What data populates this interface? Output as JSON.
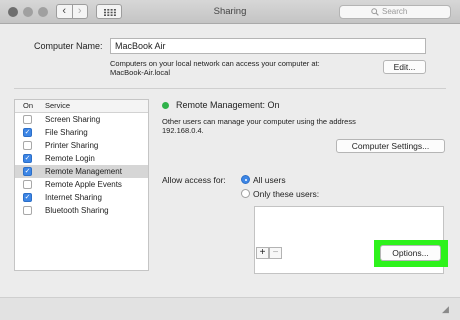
{
  "window": {
    "title": "Sharing",
    "search_placeholder": "Search",
    "nav_back": "‹",
    "nav_forward": "›",
    "traffic_light_colors": [
      "#6e6e6e",
      "#a0a0a0",
      "#a0a0a0"
    ]
  },
  "computer": {
    "name_label": "Computer Name:",
    "name_value": "MacBook Air",
    "info_line1": "Computers on your local network can access your computer at:",
    "info_line2": "MacBook-Air.local",
    "edit_label": "Edit..."
  },
  "services": {
    "header_on": "On",
    "header_service": "Service",
    "items": [
      {
        "label": "Screen Sharing",
        "checked": false
      },
      {
        "label": "File Sharing",
        "checked": true
      },
      {
        "label": "Printer Sharing",
        "checked": false
      },
      {
        "label": "Remote Login",
        "checked": true
      },
      {
        "label": "Remote Management",
        "checked": true,
        "selected": true
      },
      {
        "label": "Remote Apple Events",
        "checked": false
      },
      {
        "label": "Internet Sharing",
        "checked": true
      },
      {
        "label": "Bluetooth Sharing",
        "checked": false
      }
    ]
  },
  "detail": {
    "status_title": "Remote Management: On",
    "status_color": "#2fb24a",
    "desc_line1": "Other users can manage your computer using the address",
    "desc_line2": "192.168.0.4.",
    "settings_button": "Computer Settings...",
    "access_label": "Allow access for:",
    "radio_all": "All users",
    "radio_only": "Only these users:",
    "selected_access": "All users",
    "add_label": "+",
    "remove_label": "−",
    "options_button": "Options...",
    "highlight_color": "#2df21b"
  }
}
